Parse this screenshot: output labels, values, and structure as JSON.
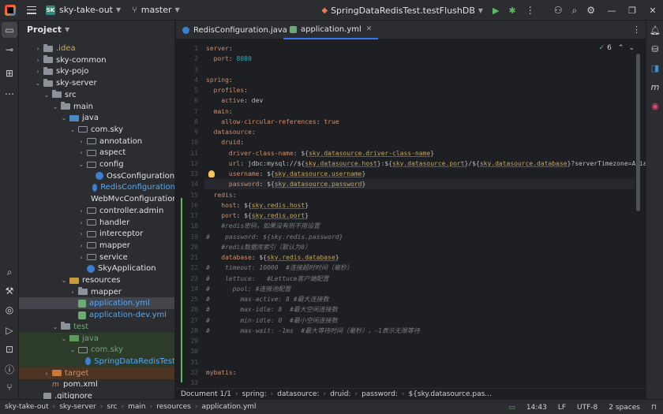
{
  "titlebar": {
    "project_badge": "SK",
    "project_name": "sky-take-out",
    "branch": "master",
    "run_config": "SpringDataRedisTest.testFlushDB"
  },
  "project_panel": {
    "title": "Project",
    "tree": [
      {
        "label": ".idea",
        "depth": 1,
        "arrow": "right",
        "icon": "folder",
        "style": "dim"
      },
      {
        "label": "sky-common",
        "depth": 1,
        "arrow": "right",
        "icon": "folder",
        "style": "bold"
      },
      {
        "label": "sky-pojo",
        "depth": 1,
        "arrow": "right",
        "icon": "folder",
        "style": "bold"
      },
      {
        "label": "sky-server",
        "depth": 1,
        "arrow": "down",
        "icon": "folder",
        "style": "bold"
      },
      {
        "label": "src",
        "depth": 2,
        "arrow": "down",
        "icon": "folder",
        "style": ""
      },
      {
        "label": "main",
        "depth": 3,
        "arrow": "down",
        "icon": "folder",
        "style": ""
      },
      {
        "label": "java",
        "depth": 4,
        "arrow": "down",
        "icon": "src",
        "style": ""
      },
      {
        "label": "com.sky",
        "depth": 5,
        "arrow": "down",
        "icon": "pkg",
        "style": ""
      },
      {
        "label": "annotation",
        "depth": 6,
        "arrow": "right",
        "icon": "pkg",
        "style": ""
      },
      {
        "label": "aspect",
        "depth": 6,
        "arrow": "right",
        "icon": "pkg",
        "style": ""
      },
      {
        "label": "config",
        "depth": 6,
        "arrow": "down",
        "icon": "pkg",
        "style": ""
      },
      {
        "label": "OssConfiguration",
        "depth": 7,
        "arrow": "",
        "icon": "cls",
        "style": ""
      },
      {
        "label": "RedisConfiguration",
        "depth": 7,
        "arrow": "",
        "icon": "cls",
        "style": "blue"
      },
      {
        "label": "WebMvcConfiguration",
        "depth": 7,
        "arrow": "",
        "icon": "cls",
        "style": ""
      },
      {
        "label": "controller.admin",
        "depth": 6,
        "arrow": "right",
        "icon": "pkg",
        "style": ""
      },
      {
        "label": "handler",
        "depth": 6,
        "arrow": "right",
        "icon": "pkg",
        "style": ""
      },
      {
        "label": "interceptor",
        "depth": 6,
        "arrow": "right",
        "icon": "pkg",
        "style": ""
      },
      {
        "label": "mapper",
        "depth": 6,
        "arrow": "right",
        "icon": "pkg",
        "style": ""
      },
      {
        "label": "service",
        "depth": 6,
        "arrow": "right",
        "icon": "pkg",
        "style": ""
      },
      {
        "label": "SkyApplication",
        "depth": 6,
        "arrow": "",
        "icon": "cls",
        "style": ""
      },
      {
        "label": "resources",
        "depth": 4,
        "arrow": "down",
        "icon": "res",
        "style": ""
      },
      {
        "label": "mapper",
        "depth": 5,
        "arrow": "right",
        "icon": "folder",
        "style": ""
      },
      {
        "label": "application.yml",
        "depth": 5,
        "arrow": "",
        "icon": "yml",
        "style": "blue",
        "selected": true
      },
      {
        "label": "application-dev.yml",
        "depth": 5,
        "arrow": "",
        "icon": "yml",
        "style": "blue"
      },
      {
        "label": "test",
        "depth": 3,
        "arrow": "down",
        "icon": "folder",
        "style": "green"
      },
      {
        "label": "java",
        "depth": 4,
        "arrow": "down",
        "icon": "test",
        "style": "green",
        "row": "green"
      },
      {
        "label": "com.sky",
        "depth": 5,
        "arrow": "down",
        "icon": "pkg",
        "style": "green",
        "row": "green"
      },
      {
        "label": "SpringDataRedisTest",
        "depth": 6,
        "arrow": "",
        "icon": "cls",
        "style": "blue",
        "row": "green"
      },
      {
        "label": "target",
        "depth": 2,
        "arrow": "right",
        "icon": "target",
        "style": "orange",
        "row": "orange"
      },
      {
        "label": "pom.xml",
        "depth": 2,
        "arrow": "",
        "icon": "xml",
        "style": ""
      },
      {
        "label": ".gitignore",
        "depth": 1,
        "arrow": "",
        "icon": "git",
        "style": ""
      }
    ]
  },
  "tabs": [
    {
      "label": "RedisConfiguration.java",
      "icon": "class",
      "active": false
    },
    {
      "label": "application.yml",
      "icon": "yaml",
      "active": true
    }
  ],
  "inspection": {
    "count": "6"
  },
  "editor": {
    "lines": [
      {
        "n": "1",
        "html": "<span class='k'>server</span>:"
      },
      {
        "n": "2",
        "html": "  <span class='k'>port</span>: <span class='n'>8080</span>"
      },
      {
        "n": "3",
        "html": ""
      },
      {
        "n": "4",
        "html": "<span class='k'>spring</span>:"
      },
      {
        "n": "5",
        "html": "  <span class='k'>profiles</span>:"
      },
      {
        "n": "6",
        "html": "    <span class='k'>active</span>: dev"
      },
      {
        "n": "7",
        "html": "  <span class='k'>main</span>:"
      },
      {
        "n": "8",
        "html": "    <span class='k'>allow-circular-references</span>: <span class='k'>true</span>"
      },
      {
        "n": "9",
        "html": "  <span class='k'>datasource</span>:"
      },
      {
        "n": "10",
        "html": "    <span class='k'>druid</span>:"
      },
      {
        "n": "11",
        "html": "      <span class='k'>driver-class-name</span>: ${<span class='hl'>sky.datasource.driver-class-name</span>}"
      },
      {
        "n": "12",
        "html": "      <span class='k'>url</span>: jdbc:mysql://${<span class='hl'>sky.datasource.host</span>}:${<span class='hl'>sky.datasource.port</span>}/${<span class='hl'>sky.datasource.database</span>}?serverTimezone=Asia/Shar"
      },
      {
        "n": "13",
        "html": "      <span class='k'>username</span>: ${<span class='hl'>sky.datasource.username</span>}"
      },
      {
        "n": "14",
        "html": "      <span class='k'>password</span>: ${<span class='hl'>sky.datasource.password</span>}"
      },
      {
        "n": "15",
        "html": "  <span class='k'>redis</span>:"
      },
      {
        "n": "16",
        "html": "    <span class='k'>host</span>: ${<span class='hl'>sky.redis.host</span>}"
      },
      {
        "n": "17",
        "html": "    <span class='k'>port</span>: ${<span class='hl'>sky.redis.port</span>}"
      },
      {
        "n": "18",
        "html": "    <span class='c'>#redis密码，如果没有则不用设置</span>"
      },
      {
        "n": "19",
        "html": "<span class='c'>#    password: ${sky.redis.password}</span>"
      },
      {
        "n": "20",
        "html": "    <span class='c'>#redis数据库索引（默认为0）</span>"
      },
      {
        "n": "21",
        "html": "    <span class='k'>database</span>: ${<span class='hl'>sky.redis.database</span>}"
      },
      {
        "n": "22",
        "html": "<span class='c'>#    timeout: 10000  #连接超时时间（毫秒）</span>"
      },
      {
        "n": "23",
        "html": "<span class='c'>#    lettuce:   #Lettuce客户端配置</span>"
      },
      {
        "n": "24",
        "html": "<span class='c'>#      pool: #连接池配置</span>"
      },
      {
        "n": "25",
        "html": "<span class='c'>#        max-active: 8 #最大连接数</span>"
      },
      {
        "n": "26",
        "html": "<span class='c'>#        max-idle: 8  #最大空闲连接数</span>"
      },
      {
        "n": "27",
        "html": "<span class='c'>#        min-idle: 0  #最小空闲连接数</span>"
      },
      {
        "n": "28",
        "html": "<span class='c'>#        max-wait: -1ms  #最大等待时间（毫秒），-1表示无限等待</span>"
      },
      {
        "n": "29",
        "html": ""
      },
      {
        "n": "30",
        "html": ""
      },
      {
        "n": "31",
        "html": ""
      },
      {
        "n": "32",
        "html": "<span class='k'>mybatis</span>:"
      },
      {
        "n": "33",
        "html": ""
      }
    ]
  },
  "breadcrumbs": [
    "Document 1/1",
    "spring:",
    "datasource:",
    "druid:",
    "password:",
    "${sky.datasource.pas..."
  ],
  "statusbar": {
    "path": [
      "sky-take-out",
      "sky-server",
      "src",
      "main",
      "resources",
      "application.yml"
    ],
    "time": "14:43",
    "line_sep": "LF",
    "encoding": "UTF-8",
    "indent": "2 spaces"
  },
  "colors": {
    "accent": "#3574f0",
    "keyword": "#cf8e6d",
    "comment": "#7a7e85",
    "number": "#2aacb8",
    "placeholder": "#c7a65d"
  }
}
